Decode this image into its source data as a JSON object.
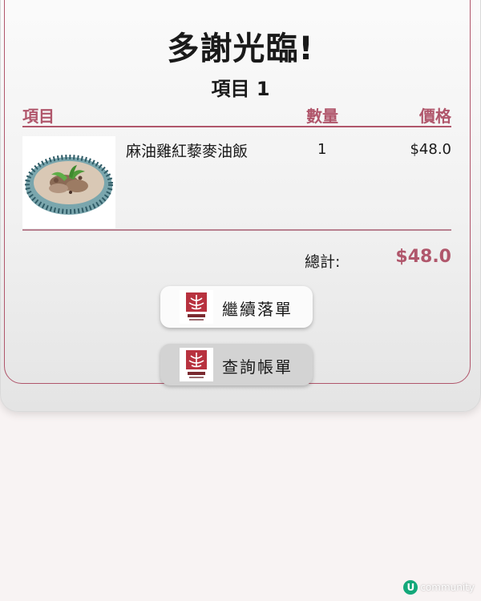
{
  "header": {
    "title": "多謝光臨!",
    "subtitle": "項目 1"
  },
  "table": {
    "columns": [
      "項目",
      "數量",
      "價格"
    ],
    "rows": [
      {
        "name": "麻油雞紅藜麥油飯",
        "qty": "1",
        "price": "$48.0",
        "image": "rice-bowl"
      }
    ]
  },
  "summary": {
    "total_label": "總計:",
    "total_value": "$48.0"
  },
  "buttons": [
    {
      "label": "繼續落單",
      "icon": "restaurant-logo"
    },
    {
      "label": "查詢帳單",
      "icon": "restaurant-logo"
    }
  ],
  "watermark": {
    "text": "community",
    "icon_letter": "U"
  },
  "colors": {
    "accent": "#b0566b",
    "page_bg": "#f8f3f3",
    "button_primary": "#fbfbfb",
    "button_secondary": "#d3d3d3"
  }
}
